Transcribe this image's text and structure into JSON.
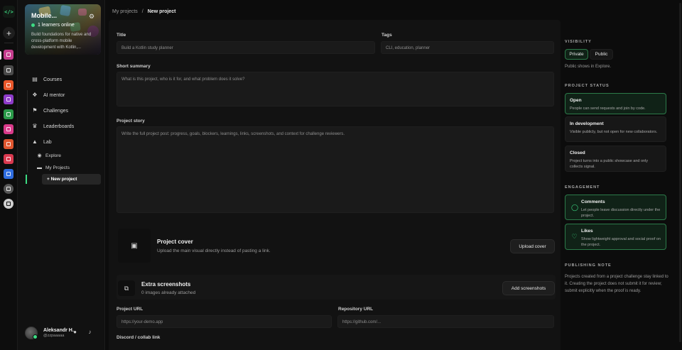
{
  "rail": {
    "logo_text": "</>",
    "add_label": "+",
    "apps": [
      {
        "name": "app-1",
        "color": "#c53d8e"
      },
      {
        "name": "app-2",
        "color": "#4a4a4a"
      },
      {
        "name": "app-3",
        "color": "#e8562a"
      },
      {
        "name": "app-4",
        "color": "#8e3bc9"
      },
      {
        "name": "app-5",
        "color": "#2b9b4a"
      },
      {
        "name": "app-6",
        "color": "#d93a8a"
      },
      {
        "name": "app-7",
        "color": "#e0562f"
      },
      {
        "name": "app-8",
        "color": "#d9394f"
      },
      {
        "name": "app-9",
        "color": "#2f6de0"
      },
      {
        "name": "app-10",
        "color": "#555555"
      },
      {
        "name": "app-11",
        "color": "#cfcfcf"
      }
    ]
  },
  "sidebar": {
    "course": {
      "title": "Mobile...",
      "online": "1 learners online",
      "description": "Build foundations for native and cross-platform mobile development with Kotlin,..."
    },
    "nav": {
      "courses": "Courses",
      "ai_mentor": "AI mentor",
      "challenges": "Challenges",
      "leaderboards": "Leaderboards",
      "lab": "Lab",
      "explore": "Explore",
      "my_projects": "My Projects",
      "new_project": "+ New project"
    },
    "user": {
      "name": "Aleksandr H.",
      "handle": "@zzpaaaaa"
    }
  },
  "breadcrumb": {
    "parent": "My projects",
    "separator": "/",
    "current": "New project"
  },
  "form": {
    "title_label": "Title",
    "title_placeholder": "Build a Kotlin study planner",
    "tags_label": "Tags",
    "tags_placeholder": "CLI, education, planner",
    "summary_label": "Short summary",
    "summary_placeholder": "What is this project, who is it for, and what problem does it solve?",
    "story_label": "Project story",
    "story_placeholder": "Write the full project post: progress, goals, blockers, learnings, links, screenshots, and context for challenge reviewers.",
    "cover_title": "Project cover",
    "cover_sub": "Upload the main visual directly instead of pasting a link.",
    "cover_button": "Upload cover",
    "shots_title": "Extra screenshots",
    "shots_sub": "0 images already attached",
    "shots_button": "Add screenshots",
    "url_label": "Project URL",
    "url_placeholder": "https://your-demo.app",
    "repo_label": "Repository URL",
    "repo_placeholder": "https://github.com/...",
    "discord_label": "Discord / collab link"
  },
  "settings": {
    "visibility_heading": "Visibility",
    "private_label": "Private",
    "public_label": "Public",
    "visibility_hint": "Public shows in Explore.",
    "status_heading": "Project status",
    "statuses": [
      {
        "title": "Open",
        "desc": "People can send requests and join by code."
      },
      {
        "title": "In development",
        "desc": "Visible publicly, but not open for new collaborators."
      },
      {
        "title": "Closed",
        "desc": "Project turns into a public showcase and only collects signal."
      }
    ],
    "engagement_heading": "Engagement",
    "comments_title": "Comments",
    "comments_desc": "Let people leave discussion directly under the project.",
    "likes_title": "Likes",
    "likes_desc": "Show lightweight approval and social proof on the project.",
    "note_heading": "Publishing note",
    "note_text": "Projects created from a project challenge stay linked to it. Creating the project does not submit it for review; submit explicitly when the proof is ready."
  },
  "colors": {
    "accent": "#3ddc84",
    "selected_bg": "#102217",
    "selected_border": "#2c7a49"
  }
}
